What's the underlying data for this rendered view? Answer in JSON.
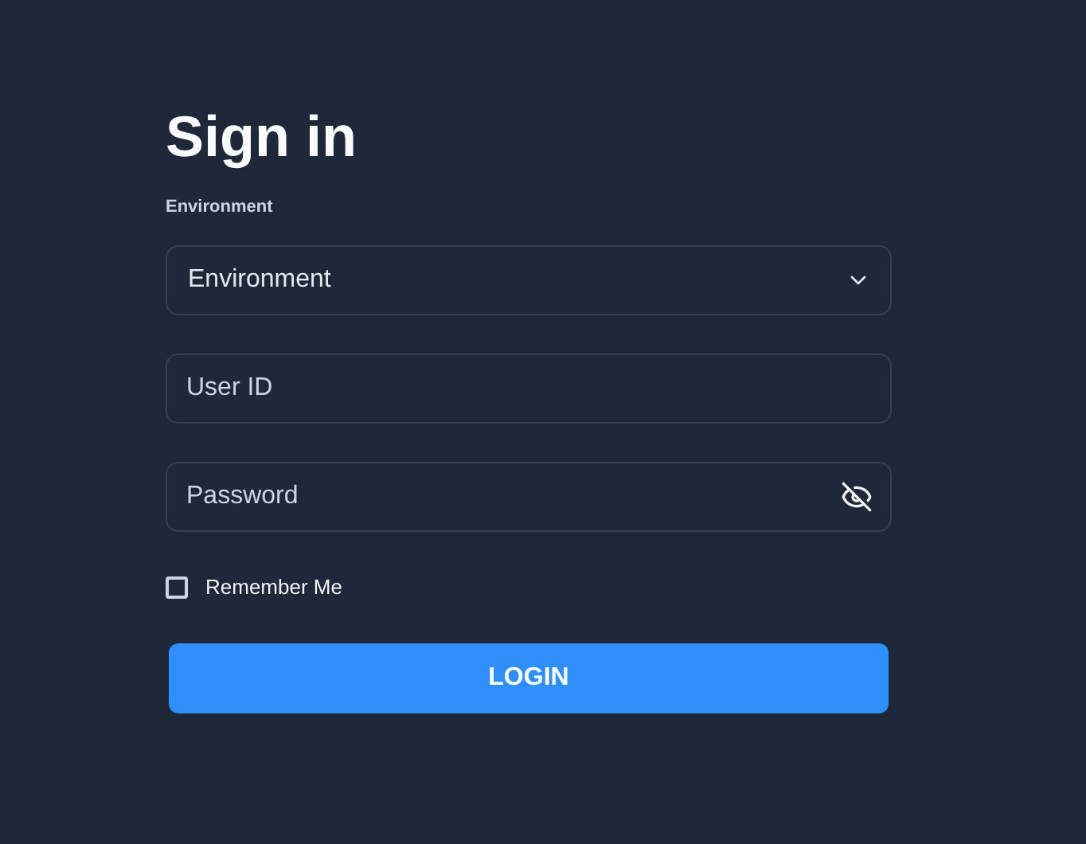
{
  "title": "Sign in",
  "environment": {
    "label": "Environment",
    "placeholder": "Environment"
  },
  "user_id": {
    "placeholder": "User ID"
  },
  "password": {
    "placeholder": "Password"
  },
  "remember_me": {
    "label": "Remember Me",
    "checked": false
  },
  "login_button": "LOGIN"
}
